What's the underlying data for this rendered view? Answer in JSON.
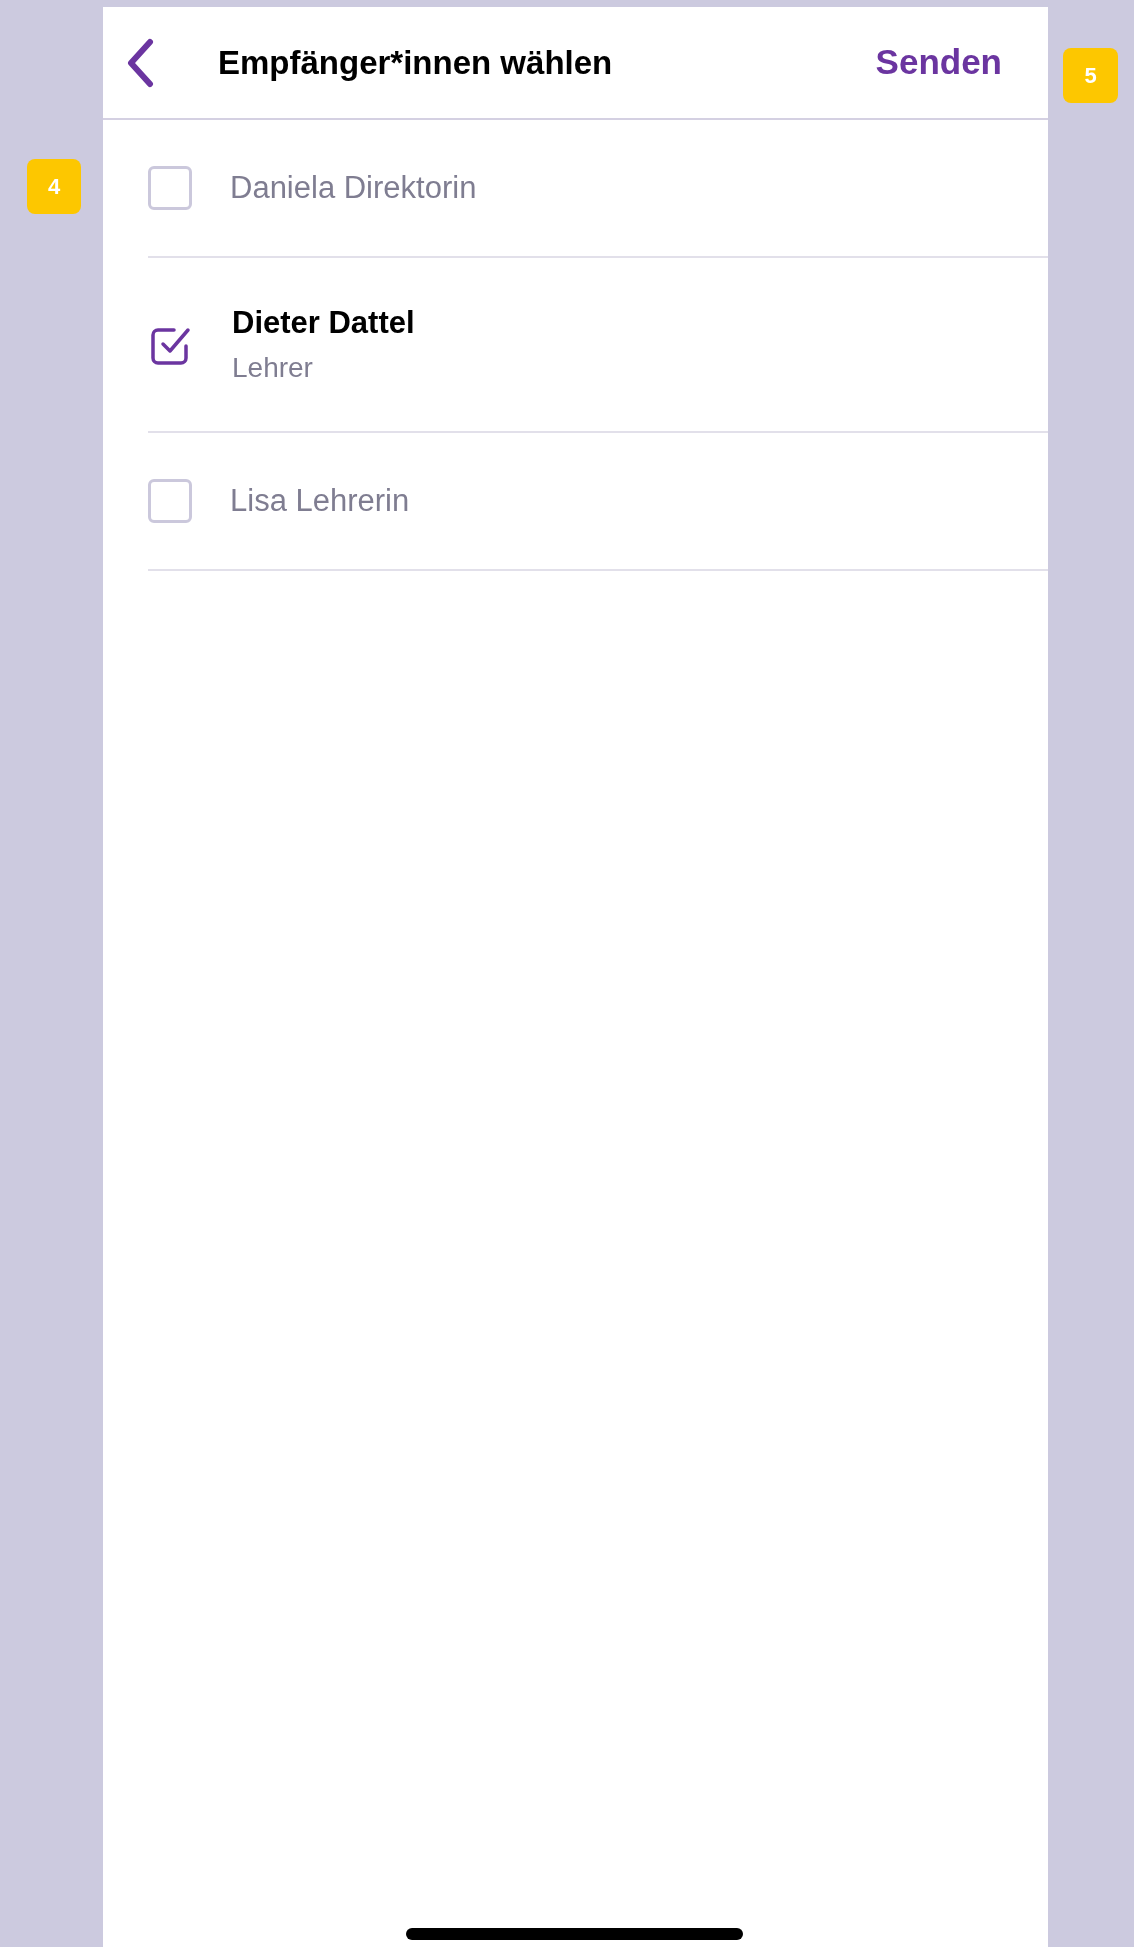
{
  "header": {
    "title": "Empfänger*innen wählen",
    "action": "Senden"
  },
  "annotations": [
    {
      "label": "4"
    },
    {
      "label": "5"
    }
  ],
  "recipients": [
    {
      "name": "Daniela Direktorin",
      "selected": false
    },
    {
      "name": "Dieter Dattel",
      "role": "Lehrer",
      "selected": true
    },
    {
      "name": "Lisa Lehrerin",
      "selected": false
    }
  ]
}
